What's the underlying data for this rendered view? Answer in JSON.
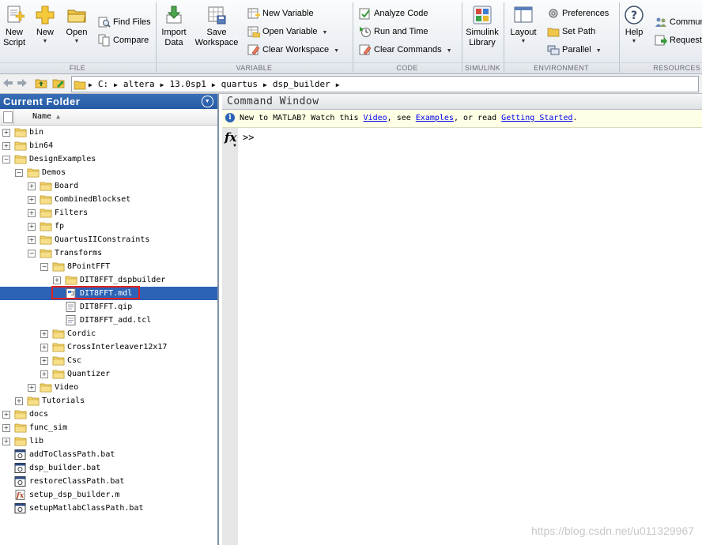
{
  "ribbon": {
    "file": {
      "section": "FILE",
      "new_script": [
        "New",
        "Script"
      ],
      "new": "New",
      "open": "Open",
      "find_files": "Find Files",
      "compare": "Compare"
    },
    "variable": {
      "section": "VARIABLE",
      "import_data": [
        "Import",
        "Data"
      ],
      "save_workspace": [
        "Save",
        "Workspace"
      ],
      "new_variable": "New Variable",
      "open_variable": "Open Variable",
      "clear_workspace": "Clear Workspace"
    },
    "code": {
      "section": "CODE",
      "analyze_code": "Analyze Code",
      "run_and_time": "Run and Time",
      "clear_commands": "Clear Commands"
    },
    "simulink": {
      "section": "SIMULINK",
      "simulink_library": [
        "Simulink",
        "Library"
      ]
    },
    "environment": {
      "section": "ENVIRONMENT",
      "layout": "Layout",
      "preferences": "Preferences",
      "set_path": "Set Path",
      "parallel": "Parallel"
    },
    "resources": {
      "section": "RESOURCES",
      "help": "Help",
      "community": "Commun",
      "request": "Request"
    }
  },
  "address": {
    "crumbs": [
      "C:",
      "altera",
      "13.0sp1",
      "quartus",
      "dsp_builder"
    ]
  },
  "current_folder": {
    "title": "Current Folder",
    "column_name": "Name",
    "items": [
      {
        "label": "bin",
        "type": "folder",
        "depth": 0,
        "toggle": "+"
      },
      {
        "label": "bin64",
        "type": "folder",
        "depth": 0,
        "toggle": "+"
      },
      {
        "label": "DesignExamples",
        "type": "folder",
        "depth": 0,
        "toggle": "-"
      },
      {
        "label": "Demos",
        "type": "folder",
        "depth": 1,
        "toggle": "-"
      },
      {
        "label": "Board",
        "type": "folder",
        "depth": 2,
        "toggle": "+"
      },
      {
        "label": "CombinedBlockset",
        "type": "folder",
        "depth": 2,
        "toggle": "+"
      },
      {
        "label": "Filters",
        "type": "folder",
        "depth": 2,
        "toggle": "+"
      },
      {
        "label": "fp",
        "type": "folder",
        "depth": 2,
        "toggle": "+"
      },
      {
        "label": "QuartusIIConstraints",
        "type": "folder",
        "depth": 2,
        "toggle": "+"
      },
      {
        "label": "Transforms",
        "type": "folder",
        "depth": 2,
        "toggle": "-"
      },
      {
        "label": "8PointFFT",
        "type": "folder",
        "depth": 3,
        "toggle": "-"
      },
      {
        "label": "DIT8FFT_dspbuilder",
        "type": "folder",
        "depth": 4,
        "toggle": "+"
      },
      {
        "label": "DIT8FFT.mdl",
        "type": "mdl",
        "depth": 4,
        "toggle": "",
        "selected": true
      },
      {
        "label": "DIT8FFT.qip",
        "type": "doc",
        "depth": 4,
        "toggle": ""
      },
      {
        "label": "DIT8FFT_add.tcl",
        "type": "doc",
        "depth": 4,
        "toggle": ""
      },
      {
        "label": "Cordic",
        "type": "folder",
        "depth": 3,
        "toggle": "+"
      },
      {
        "label": "CrossInterleaver12x17",
        "type": "folder",
        "depth": 3,
        "toggle": "+"
      },
      {
        "label": "Csc",
        "type": "folder",
        "depth": 3,
        "toggle": "+"
      },
      {
        "label": "Quantizer",
        "type": "folder",
        "depth": 3,
        "toggle": "+"
      },
      {
        "label": "Video",
        "type": "folder",
        "depth": 2,
        "toggle": "+"
      },
      {
        "label": "Tutorials",
        "type": "folder",
        "depth": 1,
        "toggle": "+"
      },
      {
        "label": "docs",
        "type": "folder",
        "depth": 0,
        "toggle": "+"
      },
      {
        "label": "func_sim",
        "type": "folder",
        "depth": 0,
        "toggle": "+"
      },
      {
        "label": "lib",
        "type": "folder",
        "depth": 0,
        "toggle": "+"
      },
      {
        "label": "addToClassPath.bat",
        "type": "bat",
        "depth": 0,
        "toggle": ""
      },
      {
        "label": "dsp_builder.bat",
        "type": "bat",
        "depth": 0,
        "toggle": ""
      },
      {
        "label": "restoreClassPath.bat",
        "type": "bat",
        "depth": 0,
        "toggle": ""
      },
      {
        "label": "setup_dsp_builder.m",
        "type": "mfile",
        "depth": 0,
        "toggle": ""
      },
      {
        "label": "setupMatlabClassPath.bat",
        "type": "bat",
        "depth": 0,
        "toggle": ""
      }
    ]
  },
  "command_window": {
    "title": "Command Window",
    "info_prefix": "New to MATLAB? Watch this ",
    "info_link_video": "Video",
    "info_mid": ", see ",
    "info_link_examples": "Examples",
    "info_mid2": ", or read ",
    "info_link_started": "Getting Started",
    "info_suffix": ".",
    "fx": "fx",
    "prompt": ">>"
  },
  "watermark": "https://blog.csdn.net/u011329967",
  "colors": {
    "selection": "#2c63b6",
    "panel_title": "#245aa5",
    "highlight_box": "#e02020",
    "folder": "#e8c24a"
  }
}
